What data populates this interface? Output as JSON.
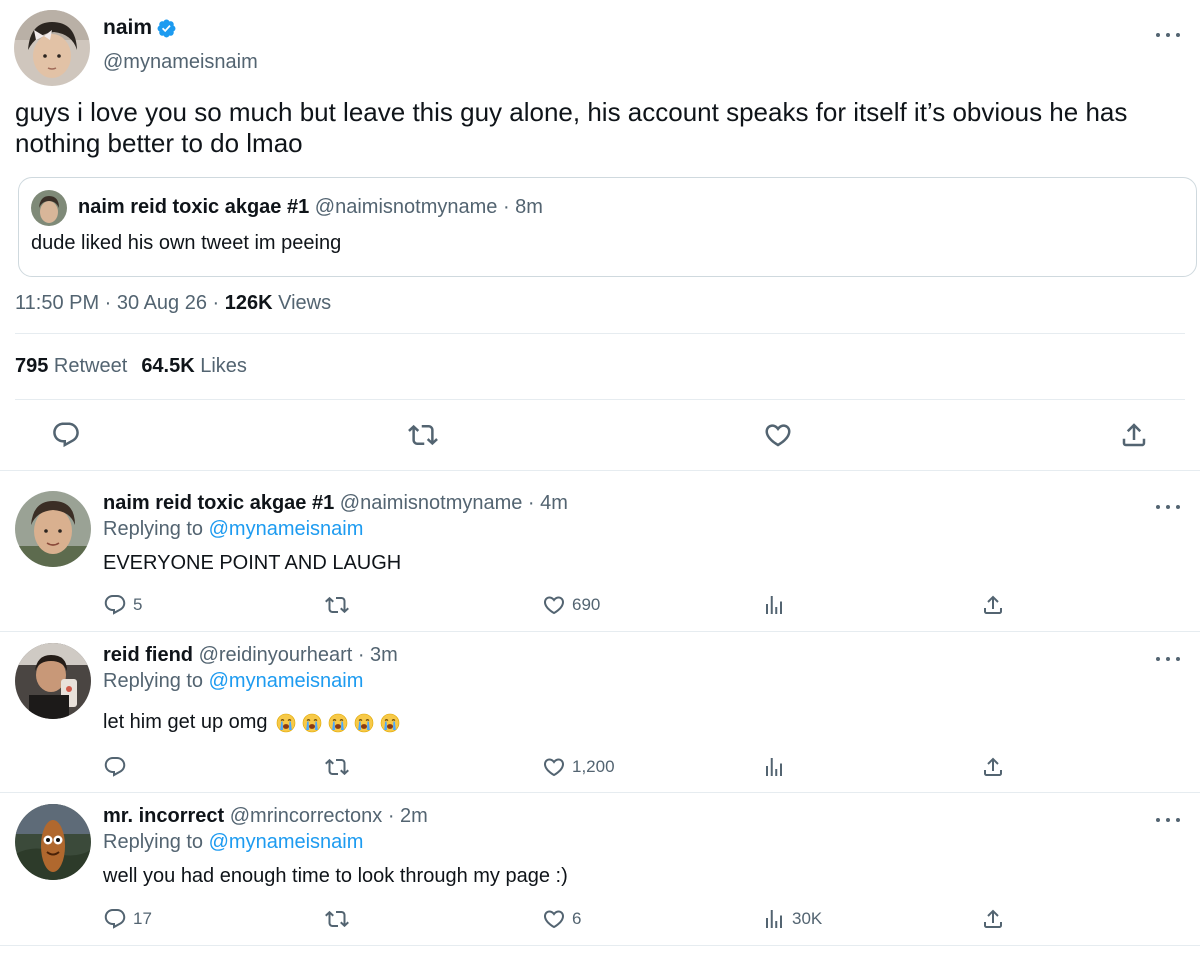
{
  "main_tweet": {
    "author_name": "naim",
    "author_handle": "@mynameisnaim",
    "text": "guys i love you so much but leave this guy alone, his account speaks for itself it’s obvious he has nothing better to do lmao",
    "quote": {
      "name": "naim reid toxic akgae #1",
      "meta": "@naimisnotmyname · 8m",
      "text": "dude liked his own tweet im peeing"
    },
    "time": "11:50 PM · 30 Aug 26 · ",
    "views_count": "126K",
    "views_label": " Views",
    "retweets_count": "795",
    "retweets_label": " Retweet",
    "likes_count": "64.5K",
    "likes_label": " Likes"
  },
  "replies": [
    {
      "name": "naim reid toxic akgae #1",
      "meta": " @naimisnotmyname · 4m",
      "replying_prefix": "Replying to ",
      "replying_to": "@mynameisnaim",
      "text": "EVERYONE POINT AND LAUGH",
      "emoji_count": 0,
      "reply_count": "5",
      "like_count": "690",
      "view_count": ""
    },
    {
      "name": "reid fiend",
      "meta": " @reidinyourheart · 3m",
      "replying_prefix": "Replying to ",
      "replying_to": "@mynameisnaim",
      "text": "let him get up omg",
      "emoji_count": 5,
      "reply_count": "",
      "like_count": "1,200",
      "view_count": ""
    },
    {
      "name": "mr. incorrect",
      "meta": " @mrincorrectonx · 2m",
      "replying_prefix": "Replying to ",
      "replying_to": "@mynameisnaim",
      "text": "well you had enough time to look through my page :)",
      "emoji_count": 0,
      "reply_count": "17",
      "like_count": "6",
      "view_count": "30K"
    }
  ],
  "colors": {
    "accent": "#1d9bf0",
    "secondary_text": "#536471",
    "border": "#e6ecf0",
    "verified": "#1d9bf0"
  },
  "icons": [
    "more-icon",
    "verified-badge-icon",
    "reply-icon",
    "retweet-icon",
    "like-icon",
    "share-icon",
    "views-icon",
    "loudly-crying-face-emoji"
  ]
}
